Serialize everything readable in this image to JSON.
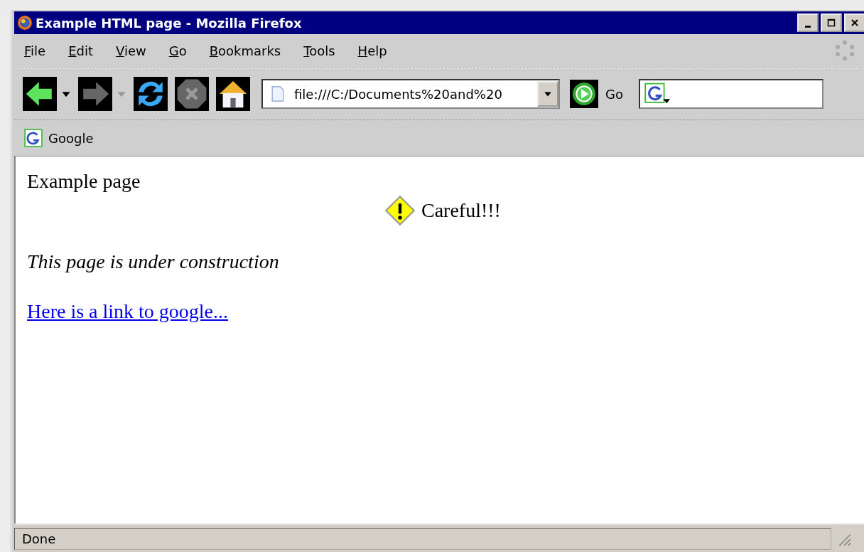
{
  "window": {
    "title": "Example HTML page - Mozilla Firefox"
  },
  "menu": [
    "File",
    "Edit",
    "View",
    "Go",
    "Bookmarks",
    "Tools",
    "Help"
  ],
  "nav_buttons": [
    {
      "kind": "back",
      "disabled": false
    },
    {
      "kind": "forward",
      "disabled": true
    },
    {
      "kind": "reload",
      "disabled": false
    },
    {
      "kind": "stop",
      "disabled": true
    },
    {
      "kind": "home",
      "disabled": false
    }
  ],
  "address_bar": {
    "value": "file:///C:/Documents%20and%20",
    "go_label": "Go"
  },
  "bookmarks": [
    {
      "label": "Google"
    }
  ],
  "page": {
    "heading": "Example page",
    "warning": "Careful!!!",
    "note": "This page is under construction",
    "link": "Here is a link to google..."
  },
  "status_bar": "Done"
}
